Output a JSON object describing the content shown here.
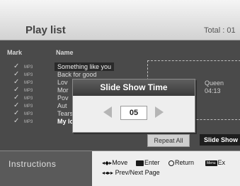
{
  "header": {
    "title": "Play list",
    "total": "Total : 01"
  },
  "list": {
    "columns": {
      "mark": "Mark",
      "name": "Name"
    },
    "items": [
      {
        "check": "✓",
        "type": "MP3",
        "name": "Something like you"
      },
      {
        "check": "✓",
        "type": "MP3",
        "name": "Back for good"
      },
      {
        "check": "✓",
        "type": "MP3",
        "name": "Lov"
      },
      {
        "check": "✓",
        "type": "MP3",
        "name": "Mor"
      },
      {
        "check": "✓",
        "type": "MP3",
        "name": "Pov"
      },
      {
        "check": "✓",
        "type": "MP3",
        "name": "Aut"
      },
      {
        "check": "✓",
        "type": "MP3",
        "name": "Tears in heaven"
      },
      {
        "check": "✓",
        "type": "MP3",
        "name": "My love"
      }
    ]
  },
  "info": {
    "artist": "Queen",
    "time": "04:13"
  },
  "buttons": {
    "repeat": "Repeat All",
    "slideshow": "Slide Show"
  },
  "dialog": {
    "title": "Slide Show Time",
    "value": "05"
  },
  "instructions": {
    "label": "Instructions",
    "move_arrows": "◂◆▸",
    "move": "Move",
    "enter": "Enter",
    "return": "Return",
    "menu_key": "Menu",
    "exit": "Ex",
    "page_arrows": "◂◂▸▸",
    "prev_next": "Prev/Next Page"
  }
}
